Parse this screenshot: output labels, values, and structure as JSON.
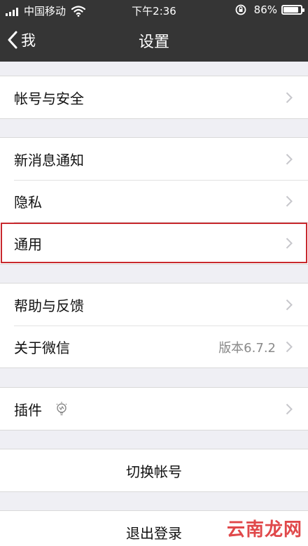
{
  "status_bar": {
    "carrier": "中国移动",
    "time": "下午2:36",
    "battery_percent": "86%",
    "battery_level": 0.86,
    "icons": [
      "signal-icon",
      "wifi-icon",
      "orientation-lock-icon",
      "battery-icon"
    ]
  },
  "navbar": {
    "back_label": "我",
    "title": "设置"
  },
  "groups": [
    {
      "items": [
        {
          "label": "帐号与安全"
        }
      ]
    },
    {
      "items": [
        {
          "label": "新消息通知"
        },
        {
          "label": "隐私"
        },
        {
          "label": "通用",
          "highlighted": true
        }
      ]
    },
    {
      "items": [
        {
          "label": "帮助与反馈"
        },
        {
          "label": "关于微信",
          "value": "版本6.7.2"
        }
      ]
    },
    {
      "items": [
        {
          "label": "插件",
          "icon": "plugin-bulb-icon"
        }
      ]
    },
    {
      "items": [
        {
          "label": "切换帐号"
        }
      ]
    },
    {
      "items": [
        {
          "label": "退出登录"
        }
      ]
    }
  ],
  "colors": {
    "header_bg": "#353535",
    "page_bg": "#efeff4",
    "highlight_border": "#c8282d"
  },
  "watermark": {
    "text": "云南龙网"
  }
}
